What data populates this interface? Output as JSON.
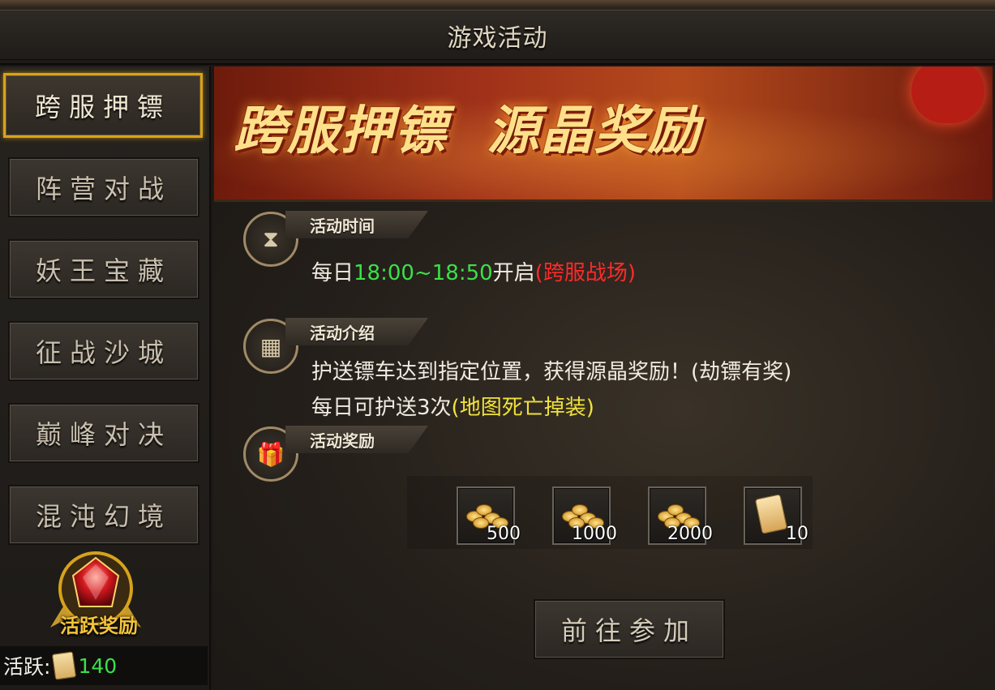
{
  "window": {
    "title": "游戏活动"
  },
  "sidebar": {
    "items": [
      {
        "label": "跨服押镖",
        "active": true
      },
      {
        "label": "阵营对战"
      },
      {
        "label": "妖王宝藏"
      },
      {
        "label": "征战沙城"
      },
      {
        "label": "巅峰对决"
      },
      {
        "label": "混沌幻境"
      }
    ],
    "badge_label": "活跃奖励",
    "activity": {
      "label": "活跃:",
      "value": "140"
    }
  },
  "banner": {
    "text": "跨服押镖  源晶奖励"
  },
  "sections": {
    "time": {
      "tag": "活动时间",
      "prefix": "每日",
      "time": "18:00~18:50",
      "suffix": "开启",
      "note": "(跨服战场)"
    },
    "intro": {
      "tag": "活动介绍",
      "line1": "护送镖车达到指定位置，获得源晶奖励！(劫镖有奖)",
      "line2_prefix": "每日可护送3次",
      "line2_note": "(地图死亡掉装)"
    },
    "rewards": {
      "tag": "活动奖励",
      "items": [
        {
          "icon": "gold-coins-icon",
          "count": "500"
        },
        {
          "icon": "gold-coins-icon",
          "count": "1000"
        },
        {
          "icon": "gold-coins-icon",
          "count": "2000"
        },
        {
          "icon": "activity-token-icon",
          "count": "10"
        }
      ]
    }
  },
  "actions": {
    "go_label": "前往参加"
  },
  "colors": {
    "accent_gold": "#d7a21c",
    "green": "#3be04a",
    "red": "#ff2a2a",
    "yellow": "#f0e23a"
  }
}
